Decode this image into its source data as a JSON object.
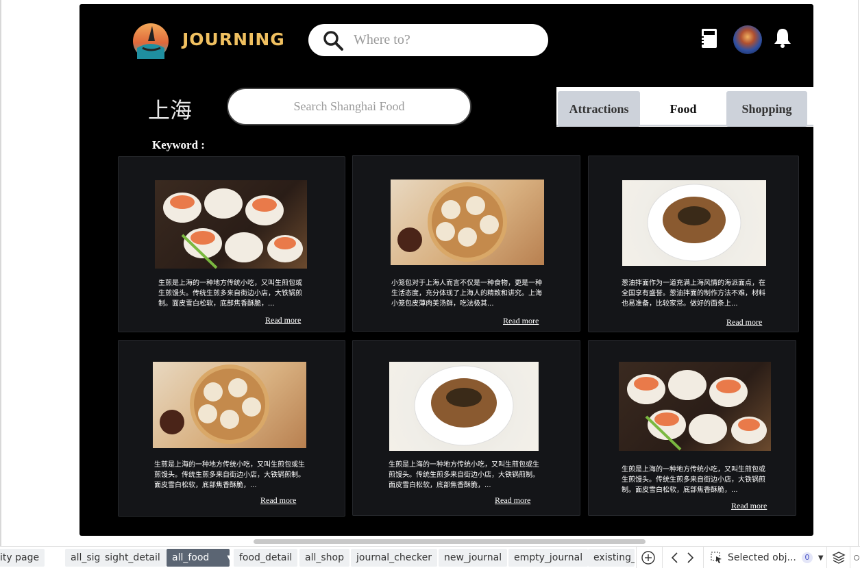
{
  "header": {
    "logo_text": "JOURNING",
    "where_placeholder": "Where to?"
  },
  "panel": {
    "city": "上海",
    "food_search_placeholder": "Search Shanghai Food",
    "tabs": [
      "Attractions",
      "Food",
      "Shopping"
    ],
    "active_tab": "Food",
    "keyword_label": "Keyword :"
  },
  "cards": [
    {
      "image": "shengjian-buns",
      "desc": "生煎是上海的一种地方传统小吃，又叫生煎包或生煎馒头。传统生煎多来自街边小店，大铁锅煎制。面皮雪白松软，底部焦香酥脆，...",
      "more": "Read more"
    },
    {
      "image": "xiaolongbao",
      "desc": "小笼包对于上海人而言不仅是一种食物，更是一种生活态度，充分体现了上海人的精致和讲究。上海小笼包皮薄肉美汤鲜，吃法极其...",
      "more": "Read more"
    },
    {
      "image": "scallion-noodles",
      "desc": "葱油拌面作为一道充满上海风情的海派面点，在全国享有盛誉。葱油拌面的制作方法不难，材料也易准备，比较家常。做好的面条上...",
      "more": "Read more"
    },
    {
      "image": "xiaolongbao",
      "desc": "生煎是上海的一种地方传统小吃，又叫生煎包或生煎馒头。传统生煎多来自街边小店，大铁锅煎制。面皮雪白松软，底部焦香酥脆，...",
      "more": "Read more"
    },
    {
      "image": "scallion-noodles",
      "desc": "生煎是上海的一种地方传统小吃，又叫生煎包或生煎馒头。传统生煎多来自街边小店，大铁锅煎制。面皮雪白松软，底部焦香酥脆，...",
      "more": "Read more"
    },
    {
      "image": "shengjian-buns",
      "desc": "生煎是上海的一种地方传统小吃，又叫生煎包或生煎馒头。传统生煎多来自街边小店，大铁锅煎制。面皮雪白松软，底部焦香酥脆，...",
      "more": "Read more"
    }
  ],
  "pagebar": {
    "pages": [
      "ity page",
      "all_sight",
      "sight_detail",
      "all_food",
      "food_detail",
      "all_shop",
      "journal_checker",
      "new_journal",
      "empty_journal",
      "existing_"
    ],
    "active_page": "all_food",
    "selected_label": "Selected obj...",
    "selected_count": "0"
  },
  "colors": {
    "artboard_bg": "#000000",
    "card_bg": "#141518",
    "tab_inactive": "#cdd2da",
    "logo_gold": "#f0c060",
    "active_page_tab": "#5b6573"
  }
}
